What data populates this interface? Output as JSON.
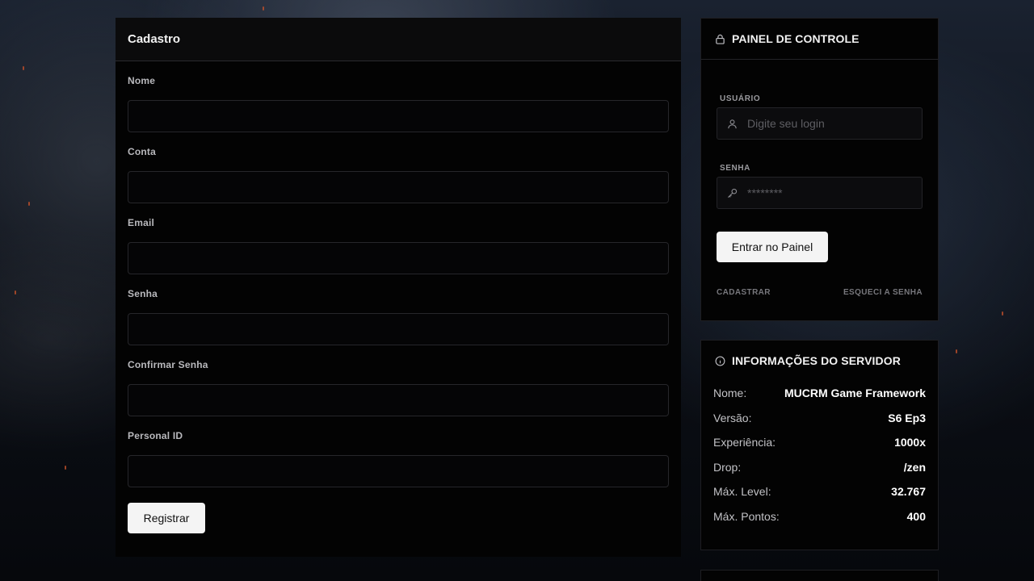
{
  "register": {
    "title": "Cadastro",
    "fields": [
      {
        "label": "Nome",
        "value": ""
      },
      {
        "label": "Conta",
        "value": ""
      },
      {
        "label": "Email",
        "value": ""
      },
      {
        "label": "Senha",
        "value": ""
      },
      {
        "label": "Confirmar Senha",
        "value": ""
      },
      {
        "label": "Personal ID",
        "value": ""
      }
    ],
    "submit_label": "Registrar"
  },
  "control_panel": {
    "title": "PAINEL DE CONTROLE",
    "username_label": "USUÁRIO",
    "username_placeholder": "Digite seu login",
    "password_label": "SENHA",
    "password_placeholder": "********",
    "login_button": "Entrar no Painel",
    "register_link": "CADASTRAR",
    "forgot_link": "ESQUECI A SENHA"
  },
  "server_info": {
    "title": "INFORMAÇÕES DO SERVIDOR",
    "rows": [
      {
        "key": "Nome:",
        "value": "MUCRM Game Framework"
      },
      {
        "key": "Versão:",
        "value": "S6 Ep3"
      },
      {
        "key": "Experiência:",
        "value": "1000x"
      },
      {
        "key": "Drop:",
        "value": "/zen"
      },
      {
        "key": "Máx. Level:",
        "value": "32.767"
      },
      {
        "key": "Máx. Pontos:",
        "value": "400"
      }
    ]
  },
  "icons": {
    "control_panel": "lock-icon",
    "server_info": "info-icon",
    "username": "user-icon",
    "password": "key-icon"
  }
}
